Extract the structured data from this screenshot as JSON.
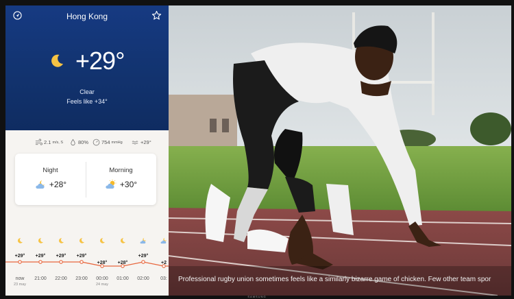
{
  "weather": {
    "city": "Hong Kong",
    "current_temp": "+29°",
    "condition": "Clear",
    "feels_like": "Feels like +34°",
    "stats": {
      "wind": "2.1",
      "wind_unit": "m/s, S",
      "humidity": "80%",
      "pressure": "754",
      "pressure_unit": "mmHg",
      "water_temp": "+29°"
    },
    "forecast": [
      {
        "label": "Night",
        "temp": "+28°",
        "icon": "cloud-moon-icon"
      },
      {
        "label": "Morning",
        "temp": "+30°",
        "icon": "cloud-sun-icon"
      }
    ],
    "hourly": [
      {
        "time": "now",
        "date": "23 may",
        "temp": "+29°",
        "icon": "moon-icon"
      },
      {
        "time": "21:00",
        "date": "",
        "temp": "+29°",
        "icon": "moon-icon"
      },
      {
        "time": "22:00",
        "date": "",
        "temp": "+29°",
        "icon": "moon-icon"
      },
      {
        "time": "23:00",
        "date": "",
        "temp": "+29°",
        "icon": "moon-icon"
      },
      {
        "time": "00:00",
        "date": "24 may",
        "temp": "+28°",
        "icon": "moon-icon"
      },
      {
        "time": "01:00",
        "date": "",
        "temp": "+28°",
        "icon": "moon-icon"
      },
      {
        "time": "02:00",
        "date": "",
        "temp": "+29°",
        "icon": "cloud-moon-icon"
      },
      {
        "time": "03:",
        "date": "",
        "temp": "+2",
        "icon": "cloud-moon-icon"
      }
    ],
    "colors": {
      "hero": "#163a82",
      "accent": "#f5a623",
      "trend_line": "#e8663d"
    }
  },
  "photo": {
    "caption": "Professional rugby union sometimes feels like a similarly bizarre game of chicken. Few other team spor"
  },
  "device": {
    "brand": "SAMSUNG"
  }
}
